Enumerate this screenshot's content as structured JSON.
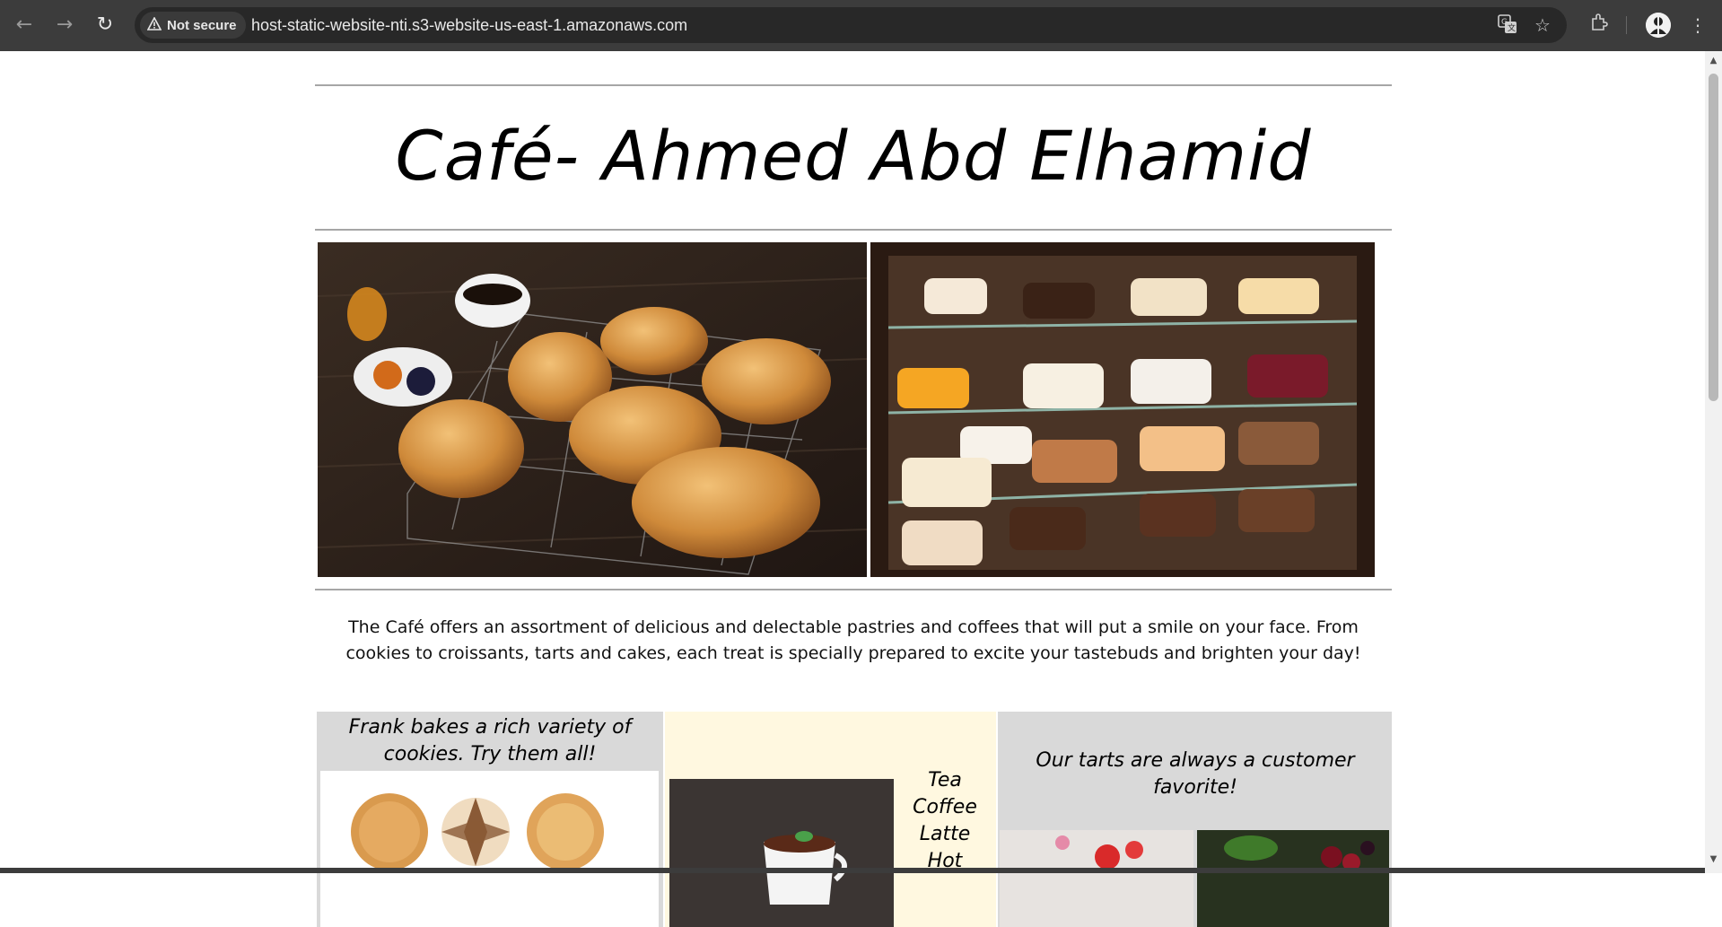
{
  "browser": {
    "security_label": "Not secure",
    "url": "host-static-website-nti.s3-website-us-east-1.amazonaws.com"
  },
  "page": {
    "title": "Café- Ahmed Abd Elhamid",
    "intro": "The Café offers an assortment of delicious and delectable pastries and coffees that will put a smile on your face. From cookies to croissants, tarts and cakes, each treat is specially prepared to excite your tastebuds and brighten your day!",
    "cookies_text": "Frank bakes a rich variety of cookies. Try them all!",
    "drinks": [
      "Tea",
      "Coffee",
      "Latte",
      "Hot"
    ],
    "tarts_text": "Our tarts are always a customer favorite!"
  },
  "colors": {
    "chrome": "#3c3c3c",
    "omnibox": "#282828",
    "column_gray": "#d9d9d9",
    "column_cream": "#fff8e0"
  }
}
